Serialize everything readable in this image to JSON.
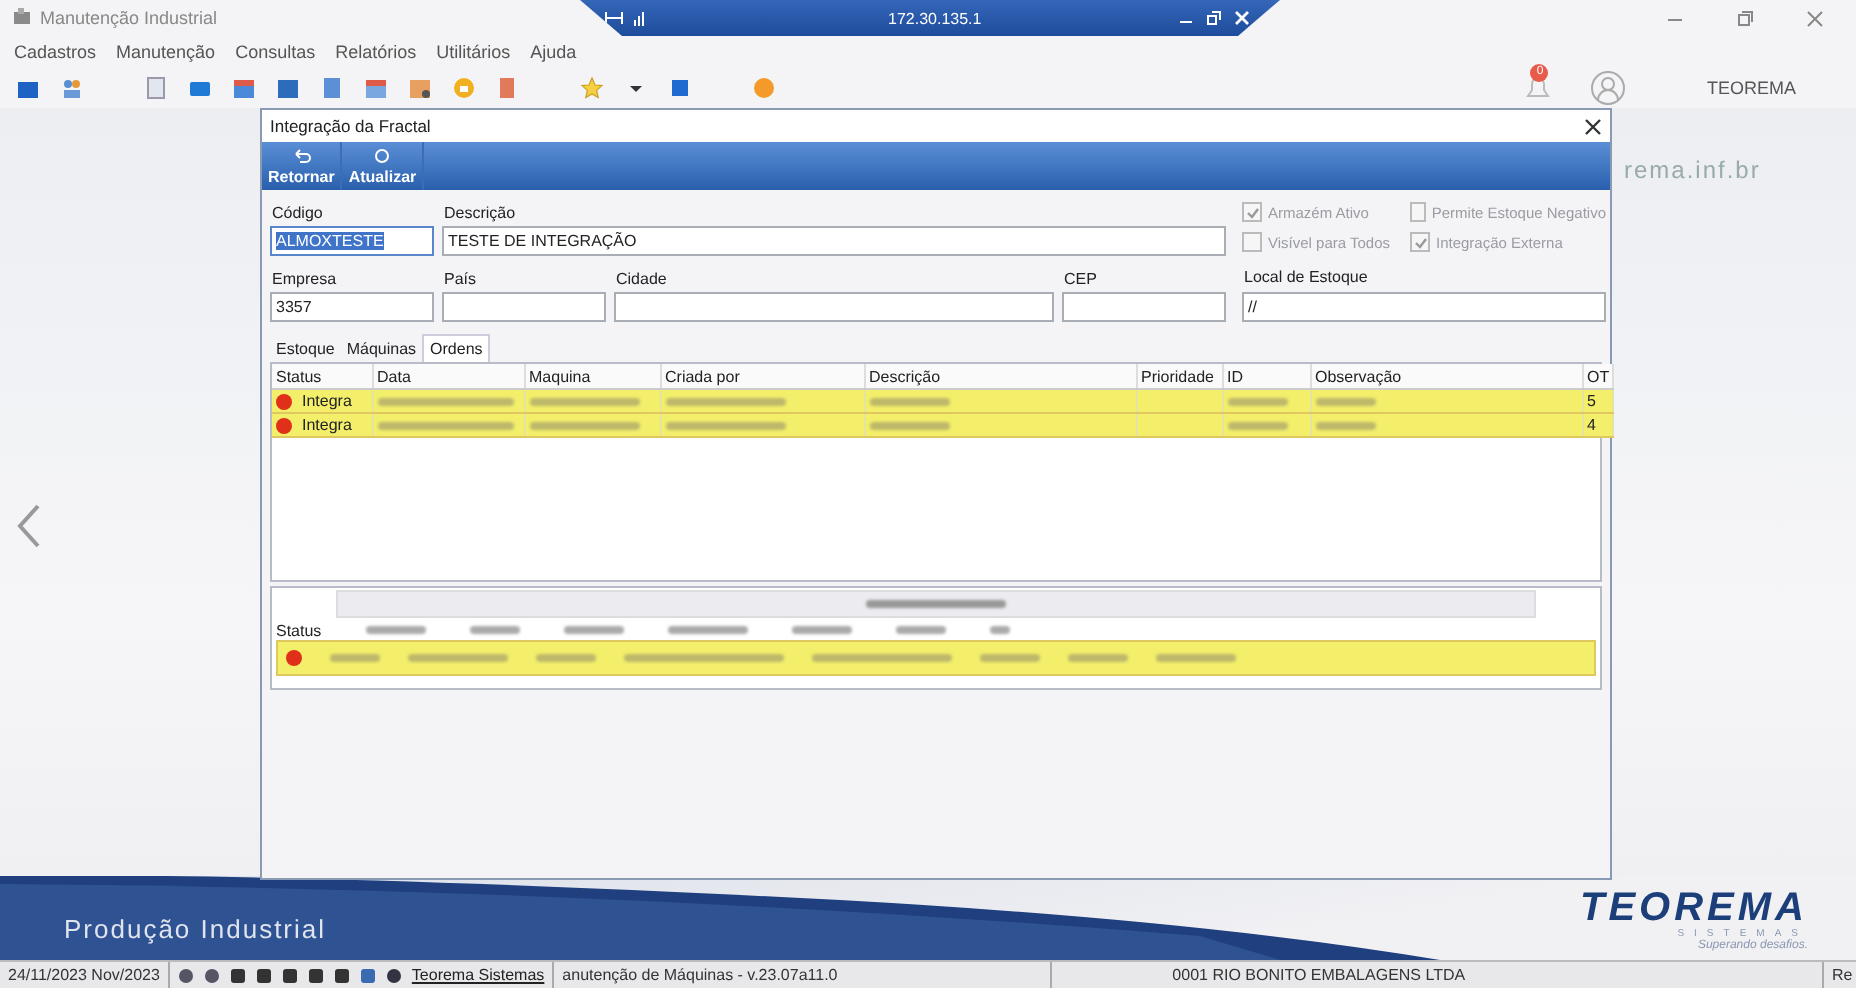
{
  "remote_bar": {
    "address": "172.30.135.1"
  },
  "app": {
    "title": "Manutenção Industrial",
    "menu": [
      "Cadastros",
      "Manutenção",
      "Consultas",
      "Relatórios",
      "Utilitários",
      "Ajuda"
    ],
    "notifications": "0",
    "user": "TEOREMA",
    "background_text": "rema.inf.br"
  },
  "dialog": {
    "title": "Integração da Fractal",
    "toolbar": [
      "Retornar",
      "Atualizar"
    ],
    "fields": [
      {
        "label": "Código",
        "value": "ALMOXTESTE",
        "selected": true
      },
      {
        "label": "Descrição",
        "value": "TESTE DE INTEGRAÇÃO",
        "selected": false
      },
      {
        "label": "Empresa",
        "value": "3357",
        "selected": false
      },
      {
        "label": "País",
        "selected": false
      },
      {
        "label": "Cidade",
        "selected": false
      },
      {
        "label": "CEP",
        "selected": false
      },
      {
        "label": "Local de Estoque",
        "value": "//",
        "selected": false
      }
    ],
    "checkboxes": [
      {
        "label": "Armazém Ativo",
        "checked": true
      },
      {
        "label": "Permite Estoque Negativo",
        "checked": false
      },
      {
        "label": "Visível para Todos",
        "checked": false
      },
      {
        "label": "Integração Externa",
        "checked": true
      }
    ],
    "tabs": [
      {
        "label": "Estoque",
        "selected": false
      },
      {
        "label": "Máquinas",
        "selected": false
      },
      {
        "label": "Ordens",
        "selected": true
      }
    ],
    "orders": {
      "columns": [
        "Status",
        "Data",
        "Maquina",
        "Criada por",
        "Descrição",
        "Prioridade",
        "ID",
        "Observação",
        "OT"
      ],
      "rows": [
        {
          "status": "Integra",
          "ot": "5",
          "highlighted": true
        },
        {
          "status": "Integra",
          "ot": "4",
          "highlighted": true
        }
      ]
    },
    "items": {
      "columns": [
        "Status"
      ],
      "rows": [
        {
          "highlighted": true
        }
      ]
    }
  },
  "banner": {
    "product": "Produção Industrial",
    "brand": "TEOREMA",
    "brand_sub": "SISTEMAS",
    "slogan": "Superando desafios."
  },
  "status_bar": {
    "date": "24/11/2023 Nov/2023",
    "link": "Teorema Sistemas",
    "module": "anutenção de Máquinas - v.23.07a11.0",
    "company": "0001 RIO BONITO EMBALAGENS LTDA",
    "extra": "Re"
  }
}
